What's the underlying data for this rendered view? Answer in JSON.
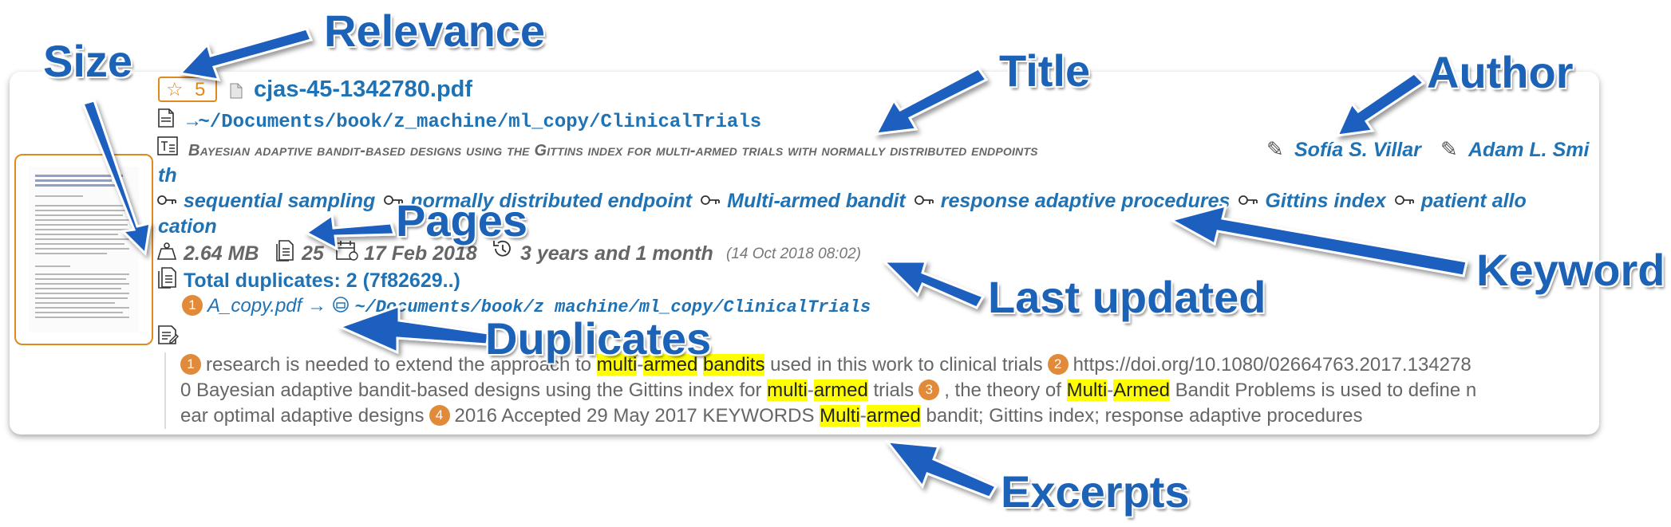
{
  "item": {
    "relevance": "5",
    "filename": "cjas-45-1342780.pdf",
    "path": "→~/Documents/book/z_machine/ml_copy/ClinicalTrials",
    "title": "Bayesian adaptive bandit-based designs using the Gittins index for multi-armed trials with normally distributed endpoints",
    "authors": [
      "Sofía S. Villar",
      "Adam L. Smi"
    ],
    "author_wrap": "th",
    "keywords": [
      "sequential sampling",
      "normally distributed endpoint",
      "Multi-armed bandit",
      "response adaptive procedures",
      "Gittins index",
      "patient allo"
    ],
    "keyword_wrap": "cation",
    "size": "2.64 MB",
    "pages": "25",
    "date": "17 Feb 2018",
    "age": "3 years and 1 month",
    "updated": "(14 Oct 2018 08:02)",
    "duplicates_summary": "Total duplicates: 2 (7f82629..)",
    "duplicate": {
      "num": "1",
      "name": "A_copy.pdf",
      "arrow": "→",
      "path": "~/Documents/book/z machine/ml_copy/ClinicalTrials"
    },
    "excerpts": {
      "line1": {
        "n1": "1",
        "t1": "research is needed to extend the approach to ",
        "h1": "multi",
        "t2": "-",
        "h2": "armed",
        "t3": " ",
        "h3": "bandits",
        "t4": " used in this work to clinical trials",
        "n2": "2",
        "t5": "https://doi.org/10.1080/02664763.2017.134278"
      },
      "line2": {
        "t1": "0 Bayesian adaptive bandit-based designs using the Gittins index for ",
        "h1": "multi",
        "t2": "-",
        "h2": "armed",
        "t3": " trials",
        "n3": "3",
        "t4": ", the theory of ",
        "h3": "Multi",
        "t5": "-",
        "h4": "Armed",
        "t6": " Bandit Problems is used to define n"
      },
      "line3": {
        "t1": "ear optimal adaptive designs",
        "n4": "4",
        "t2": "2016 Accepted 29 May 2017 KEYWORDS ",
        "h1": "Multi",
        "t3": "-",
        "h2": "armed",
        "t4": " bandit; Gittins index; response adaptive procedures"
      }
    }
  },
  "callouts": {
    "relevance": "Relevance",
    "size": "Size",
    "title": "Title",
    "author": "Author",
    "pages": "Pages",
    "keyword": "Keyword",
    "last_updated": "Last updated",
    "duplicates": "Duplicates",
    "excerpts": "Excerpts"
  },
  "colors": {
    "link_blue": "#1f73b5",
    "accent_orange": "#e08a1e",
    "highlight": "#ffff00",
    "callout_blue": "#1c63b8"
  }
}
